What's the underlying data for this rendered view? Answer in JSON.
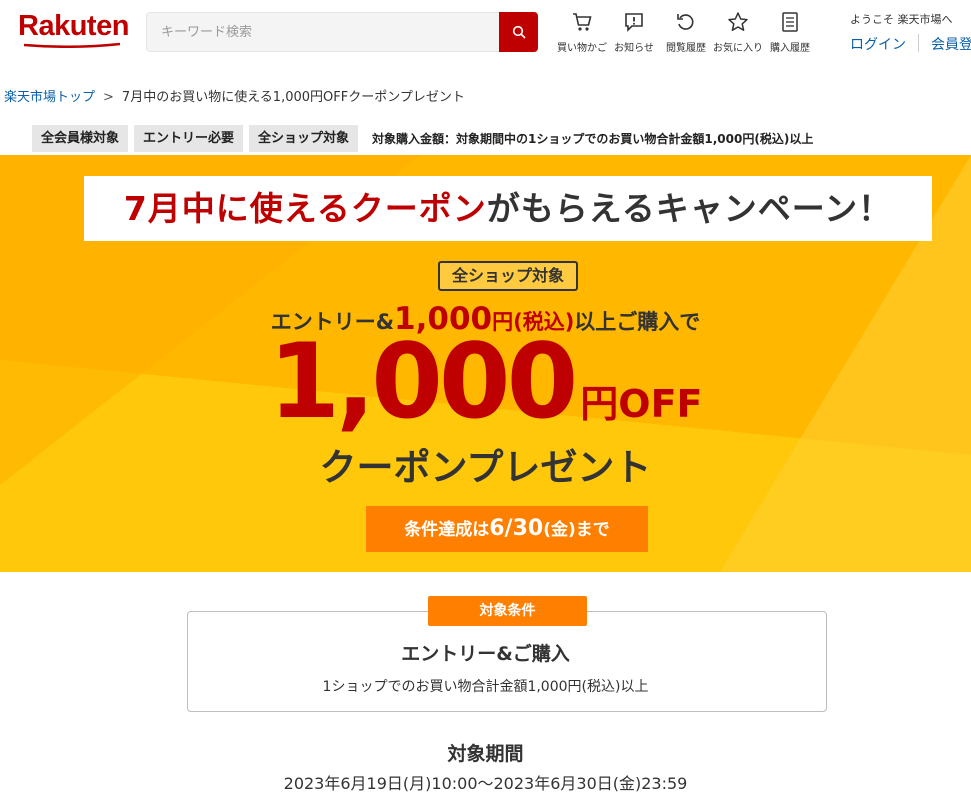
{
  "header": {
    "logo_text": "Rakuten",
    "search_placeholder": "キーワード検索",
    "nav": [
      {
        "label": "買い物かご",
        "icon": "cart-icon"
      },
      {
        "label": "お知らせ",
        "icon": "notification-icon"
      },
      {
        "label": "閲覧履歴",
        "icon": "history-icon"
      },
      {
        "label": "お気に入り",
        "icon": "star-icon"
      },
      {
        "label": "購入履歴",
        "icon": "receipt-icon"
      }
    ],
    "welcome": "ようこそ 楽天市場へ",
    "login": "ログイン",
    "register": "会員登"
  },
  "breadcrumb": {
    "home": "楽天市場トップ",
    "separator": ">",
    "current": "7月中のお買い物に使える1,000円OFFクーポンプレゼント"
  },
  "tags": [
    "全会員様対象",
    "エントリー必要",
    "全ショップ対象"
  ],
  "tag_info": "対象購入金額：対象期間中の1ショップでのお買い物合計金額1,000円(税込)以上",
  "banner": {
    "title_red": "7月中に使えるクーポン",
    "title_rest": "がもらえるキャンペーン！",
    "all_shop": "全ショップ対象",
    "entry_prefix": "エントリー&",
    "entry_amount": "1,000",
    "entry_yen": "円",
    "entry_tax": "(税込)",
    "entry_suffix": "以上ご購入で",
    "amount": "1,000",
    "unit": "円OFF",
    "present": "クーポンプレゼント",
    "deadline_prefix": "条件達成は",
    "deadline_date": "6/30",
    "deadline_day": "(金)",
    "deadline_suffix": "まで"
  },
  "conditions": {
    "label": "対象条件",
    "title": "エントリー&ご購入",
    "description": "1ショップでのお買い物合計金額1,000円(税込)以上"
  },
  "period": {
    "title": "対象期間",
    "range": "2023年6月19日(月)10:00〜2023年6月30日(金)23:59"
  },
  "colors": {
    "brand": "#bf0000",
    "banner_bg": "#ffc80a",
    "orange": "#ff7f00",
    "link": "#0a5fa8"
  }
}
